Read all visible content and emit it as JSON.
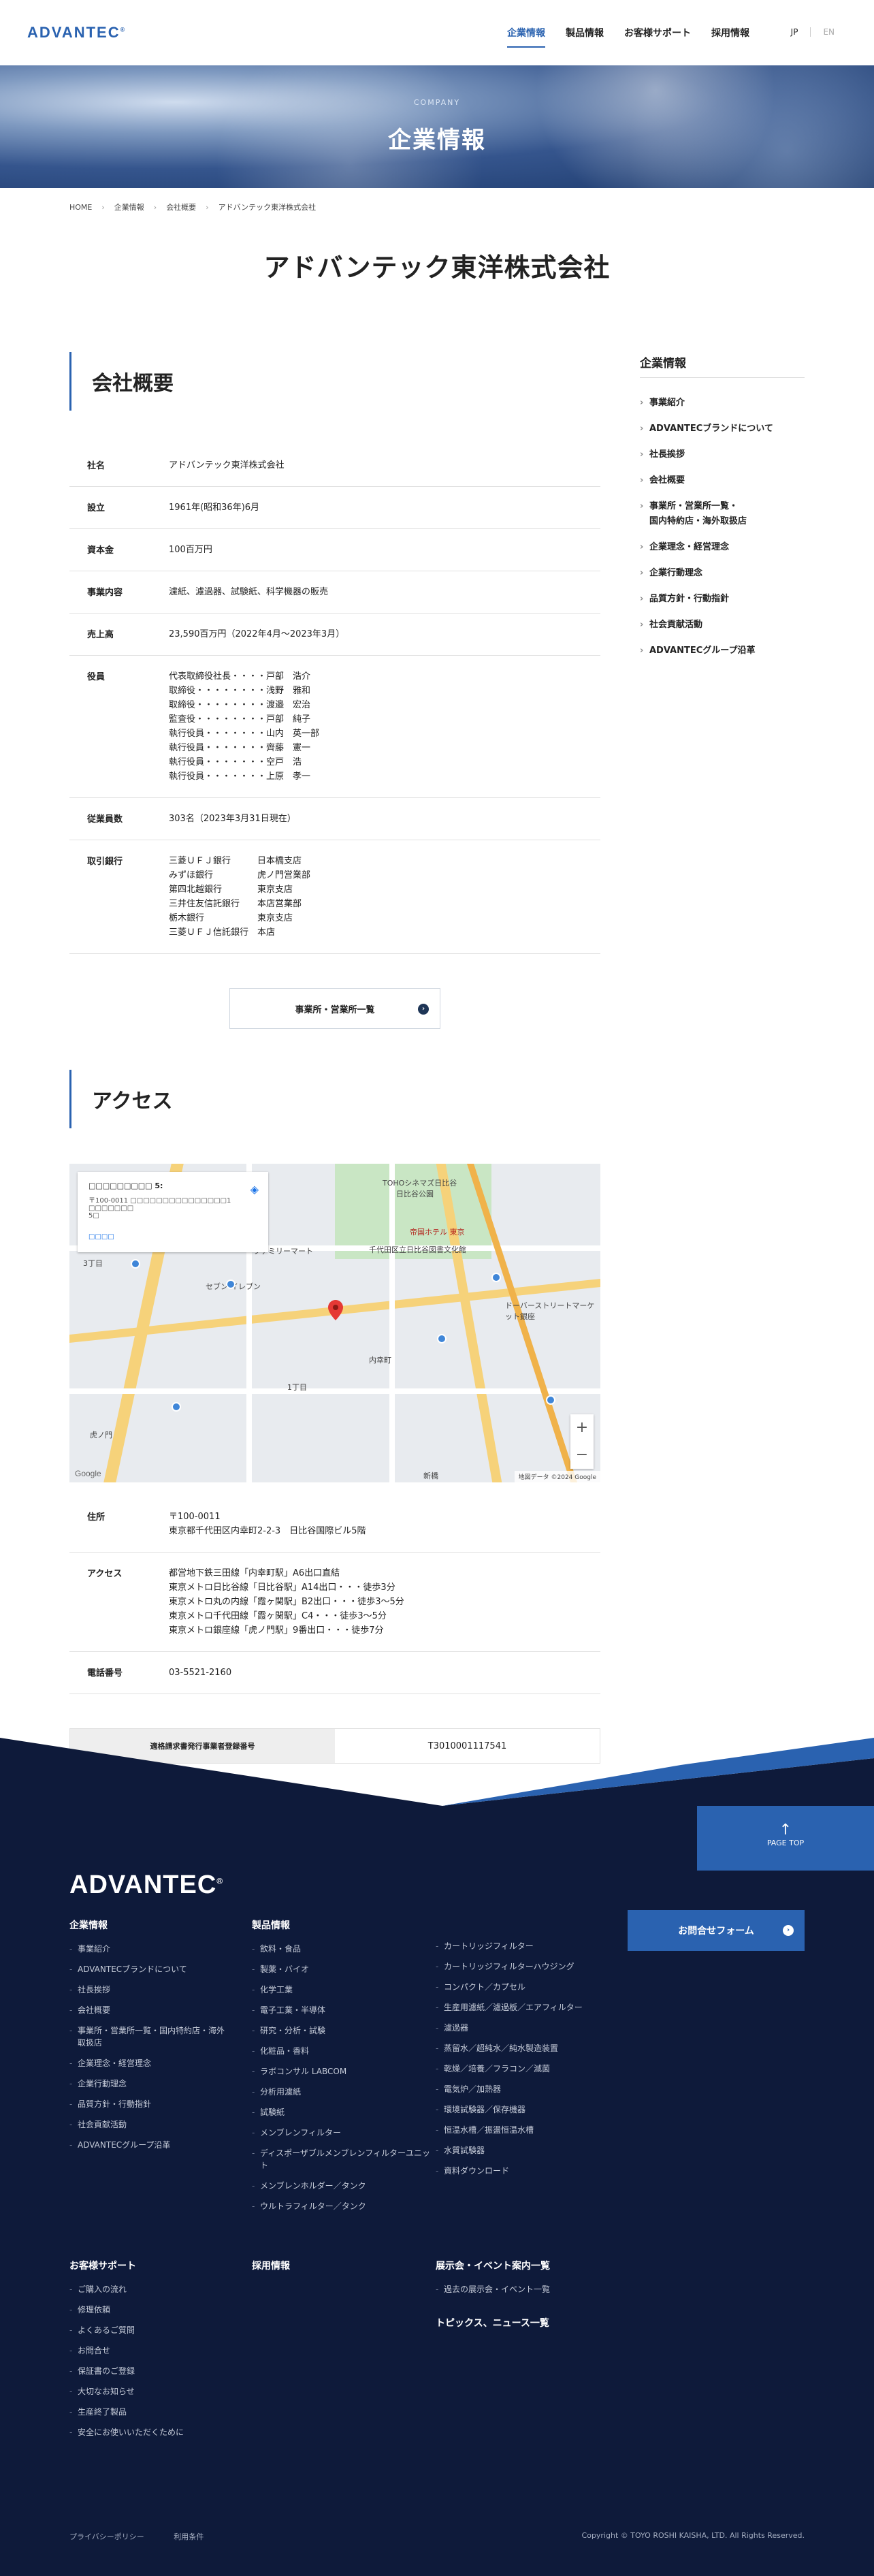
{
  "header": {
    "logo": "ADVANTEC",
    "logo_mark": "®",
    "nav": [
      "企業情報",
      "製品情報",
      "お客様サポート",
      "採用情報"
    ],
    "lang_jp": "JP",
    "lang_en": "EN"
  },
  "hero": {
    "subtitle": "COMPANY",
    "title": "企業情報"
  },
  "breadcrumb": [
    "HOME",
    "企業情報",
    "会社概要",
    "アドバンテック東洋株式会社"
  ],
  "page_title": "アドバンテック東洋株式会社",
  "overview": {
    "heading": "会社概要",
    "rows": [
      {
        "k": "社名",
        "v": "アドバンテック東洋株式会社"
      },
      {
        "k": "設立",
        "v": "1961年(昭和36年)6月"
      },
      {
        "k": "資本金",
        "v": "100百万円"
      },
      {
        "k": "事業内容",
        "v": "濾紙、濾過器、試験紙、科学機器の販売"
      },
      {
        "k": "売上高",
        "v": "23,590百万円（2022年4月〜2023年3月）"
      }
    ],
    "officers_label": "役員",
    "officers": [
      "代表取締役社長・・・・戸部　浩介",
      "取締役・・・・・・・・浅野　雅和",
      "取締役・・・・・・・・渡邉　宏治",
      "監査役・・・・・・・・戸部　純子",
      "執行役員・・・・・・・山内　英一部",
      "執行役員・・・・・・・齊藤　憲一",
      "執行役員・・・・・・・空戸　浩",
      "執行役員・・・・・・・上原　孝一"
    ],
    "employees_label": "従業員数",
    "employees": "303名（2023年3月31日現在）",
    "banks_label": "取引銀行",
    "banks": [
      "三菱ＵＦＪ銀行　　　日本橋支店",
      "みずほ銀行　　　　　虎ノ門営業部",
      "第四北越銀行　　　　東京支店",
      "三井住友信託銀行　　本店営業部",
      "栃木銀行　　　　　　東京支店",
      "三菱ＵＦＪ信託銀行　本店"
    ],
    "office_button": "事業所・営業所一覧"
  },
  "access": {
    "heading": "アクセス",
    "map": {
      "card_title": "□□□□□□□□□ 5:",
      "card_lines": [
        "〒100-0011 □□□□□□□□□□□□□□□1 □□□□□□□",
        "5□"
      ],
      "card_link": "□□□□",
      "labels": [
        "TOHOシネマズ日比谷",
        "日比谷公園",
        "帝国ホテル 東京",
        "千代田区立日比谷図書文化館",
        "セブン-イレブン",
        "ファミリーマート",
        "内幸町",
        "新橋",
        "虎ノ門",
        "1丁目",
        "3丁目",
        "ドーバーストリートマーケット銀座"
      ],
      "copyright": "地図データ ©2024 Google",
      "google": "Google"
    },
    "rows": [
      {
        "k": "住所",
        "lines": [
          "〒100-0011",
          "東京都千代田区内幸町2-2-3　日比谷国際ビル5階"
        ]
      },
      {
        "k": "アクセス",
        "lines": [
          "都営地下鉄三田線「内幸町駅」A6出口直結",
          "東京メトロ日比谷線「日比谷駅」A14出口・・・徒歩3分",
          "東京メトロ丸の内線「霞ヶ関駅」B2出口・・・徒歩3〜5分",
          "東京メトロ千代田線「霞ヶ関駅」C4・・・徒歩3〜5分",
          "東京メトロ銀座線「虎ノ門駅」9番出口・・・徒歩7分"
        ]
      },
      {
        "k": "電話番号",
        "lines": [
          "03-5521-2160"
        ]
      }
    ],
    "invoice_label": "適格請求書発行事業者登録番号",
    "invoice_value": "T3010001117541"
  },
  "sidebar": {
    "title": "企業情報",
    "items": [
      "事業紹介",
      "ADVANTECブランドについて",
      "社長挨拶",
      "会社概要",
      "事業所・営業所一覧・\n国内特約店・海外取扱店",
      "企業理念・経営理念",
      "企業行動理念",
      "品質方針・行動指針",
      "社会貢献活動",
      "ADVANTECグループ沿革"
    ]
  },
  "footer": {
    "page_top": "PAGE TOP",
    "logo": "ADVANTEC",
    "col1": {
      "title": "企業情報",
      "items": [
        "事業紹介",
        "ADVANTECブランドについて",
        "社長挨拶",
        "会社概要",
        "事業所・営業所一覧・国内特約店・海外取扱店",
        "企業理念・経営理念",
        "企業行動理念",
        "品質方針・行動指針",
        "社会貢献活動",
        "ADVANTECグループ沿革"
      ]
    },
    "col2": {
      "title": "製品情報",
      "items": [
        "飲料・食品",
        "製薬・バイオ",
        "化学工業",
        "電子工業・半導体",
        "研究・分析・試験",
        "化粧品・香料",
        "ラボコンサル LABCOM",
        "分析用濾紙",
        "試験紙",
        "メンブレンフィルター",
        "ディスポーザブルメンブレンフィルターユニット",
        "メンブレンホルダー／タンク",
        "ウルトラフィルター／タンク"
      ]
    },
    "col3": {
      "items": [
        "カートリッジフィルター",
        "カートリッジフィルターハウジング",
        "コンパクト／カプセル",
        "生産用濾紙／濾過板／エアフィルター",
        "濾過器",
        "蒸留水／超純水／純水製造装置",
        "乾燥／培養／フラコン／滅菌",
        "電気炉／加熱器",
        "環境試験器／保存機器",
        "恒温水槽／振盪恒温水槽",
        "水質試験器",
        "資料ダウンロード"
      ]
    },
    "contact": "お問合せフォーム",
    "col4": {
      "title": "お客様サポート",
      "items": [
        "ご購入の流れ",
        "修理依頼",
        "よくあるご質問",
        "お問合せ",
        "保証書のご登録",
        "大切なお知らせ",
        "生産終了製品",
        "安全にお使いいただくために"
      ]
    },
    "col5": {
      "title": "採用情報"
    },
    "col6": {
      "title": "展示会・イベント案内一覧",
      "items": [
        "過去の展示会・イベント一覧"
      ]
    },
    "col7": {
      "title": "トピックス、ニュース一覧"
    },
    "bottom_links": [
      "プライバシーポリシー",
      "利用条件"
    ],
    "copyright": "Copyright © TOYO ROSHI KAISHA, LTD. All Rights Reserved."
  }
}
